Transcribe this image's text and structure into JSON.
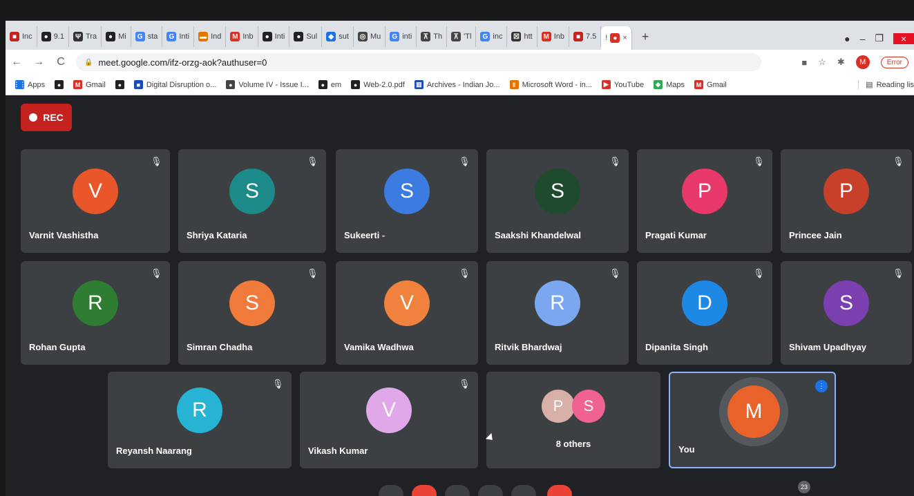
{
  "browser": {
    "tabs": [
      {
        "label": "Inc",
        "color": "#c5221f",
        "glyph": "■"
      },
      {
        "label": "9.1",
        "color": "#202124",
        "glyph": "●"
      },
      {
        "label": "Tra",
        "color": "#333333",
        "glyph": "Ψ"
      },
      {
        "label": "Mi",
        "color": "#202124",
        "glyph": "●"
      },
      {
        "label": "sta",
        "color": "#4285f4",
        "glyph": "G"
      },
      {
        "label": "Inti",
        "color": "#4285f4",
        "glyph": "G"
      },
      {
        "label": "Ind",
        "color": "#e37400",
        "glyph": "▬"
      },
      {
        "label": "Inb",
        "color": "#d93025",
        "glyph": "M"
      },
      {
        "label": "Inti",
        "color": "#202124",
        "glyph": "●"
      },
      {
        "label": "Sul",
        "color": "#202124",
        "glyph": "●"
      },
      {
        "label": "sut",
        "color": "#1a73e8",
        "glyph": "◆"
      },
      {
        "label": "Mu",
        "color": "#444444",
        "glyph": "◎"
      },
      {
        "label": "inti",
        "color": "#4285f4",
        "glyph": "G"
      },
      {
        "label": "Th",
        "color": "#444444",
        "glyph": "⊼"
      },
      {
        "label": "'Tl",
        "color": "#444444",
        "glyph": "⊼"
      },
      {
        "label": "inc",
        "color": "#4285f4",
        "glyph": "G"
      },
      {
        "label": "htt",
        "color": "#333333",
        "glyph": "☒"
      },
      {
        "label": "Inb",
        "color": "#d93025",
        "glyph": "M"
      },
      {
        "label": "7.5",
        "color": "#c5221f",
        "glyph": "■"
      }
    ],
    "active_tab": {
      "label": "!",
      "close": "×"
    },
    "new_tab": "+",
    "url": "meet.google.com/ifz-orzg-aok?authuser=0",
    "profile_initial": "M",
    "error_label": "Error",
    "bookmarks": [
      {
        "label": "Apps",
        "glyph": "⋮⋮",
        "color": "#1a73e8"
      },
      {
        "label": "",
        "glyph": "●",
        "color": "#202124"
      },
      {
        "label": "Gmail",
        "glyph": "M",
        "color": "#d93025"
      },
      {
        "label": "",
        "glyph": "●",
        "color": "#202124"
      },
      {
        "label": "Digital Disruption o...",
        "glyph": "■",
        "color": "#1a4cb8"
      },
      {
        "label": "Volume IV - Issue I...",
        "glyph": "●",
        "color": "#444444"
      },
      {
        "label": "em",
        "glyph": "●",
        "color": "#202124"
      },
      {
        "label": "Web-2.0.pdf",
        "glyph": "●",
        "color": "#202124"
      },
      {
        "label": "Archives - Indian Jo...",
        "glyph": "▥",
        "color": "#1a4cb8"
      },
      {
        "label": "Microsoft Word - in...",
        "glyph": "‖",
        "color": "#e37400"
      },
      {
        "label": "YouTube",
        "glyph": "▶",
        "color": "#d93025"
      },
      {
        "label": "Maps",
        "glyph": "◆",
        "color": "#34a853"
      },
      {
        "label": "Gmail",
        "glyph": "M",
        "color": "#d93025"
      }
    ],
    "reading_list": "Reading lis"
  },
  "meet": {
    "rec_label": "REC",
    "participants": [
      {
        "name": "Varnit Vashistha",
        "initial": "V",
        "color": "#e8562a"
      },
      {
        "name": "Shriya Kataria",
        "initial": "S",
        "color": "#1d8a8a"
      },
      {
        "name": "Sukeerti -",
        "initial": "S",
        "color": "#3c7be0"
      },
      {
        "name": "Saakshi Khandelwal",
        "initial": "S",
        "color": "#1e4a2e"
      },
      {
        "name": "Pragati Kumar",
        "initial": "P",
        "color": "#e9386a"
      },
      {
        "name": "Princee Jain",
        "initial": "P",
        "color": "#c8402a"
      },
      {
        "name": "Rohan Gupta",
        "initial": "R",
        "color": "#2e7d32"
      },
      {
        "name": "Simran Chadha",
        "initial": "S",
        "color": "#f07a3a"
      },
      {
        "name": "Vamika Wadhwa",
        "initial": "V",
        "color": "#f0823e"
      },
      {
        "name": "Ritvik Bhardwaj",
        "initial": "R",
        "color": "#7aa7f0"
      },
      {
        "name": "Dipanita Singh",
        "initial": "D",
        "color": "#1e88e5"
      },
      {
        "name": "Shivam Upadhyay",
        "initial": "S",
        "color": "#7b3fb0"
      },
      {
        "name": "Reyansh Naarang",
        "initial": "R",
        "color": "#26b3d4"
      },
      {
        "name": "Vikash Kumar",
        "initial": "V",
        "color": "#e0a8e8"
      }
    ],
    "others": {
      "label": "8 others",
      "initials": [
        "P",
        "S"
      ],
      "colors": [
        "#d9b0a8",
        "#f06292"
      ]
    },
    "you": {
      "name": "You",
      "initial": "M",
      "color": "#e8622a"
    },
    "participants_count": "23"
  }
}
